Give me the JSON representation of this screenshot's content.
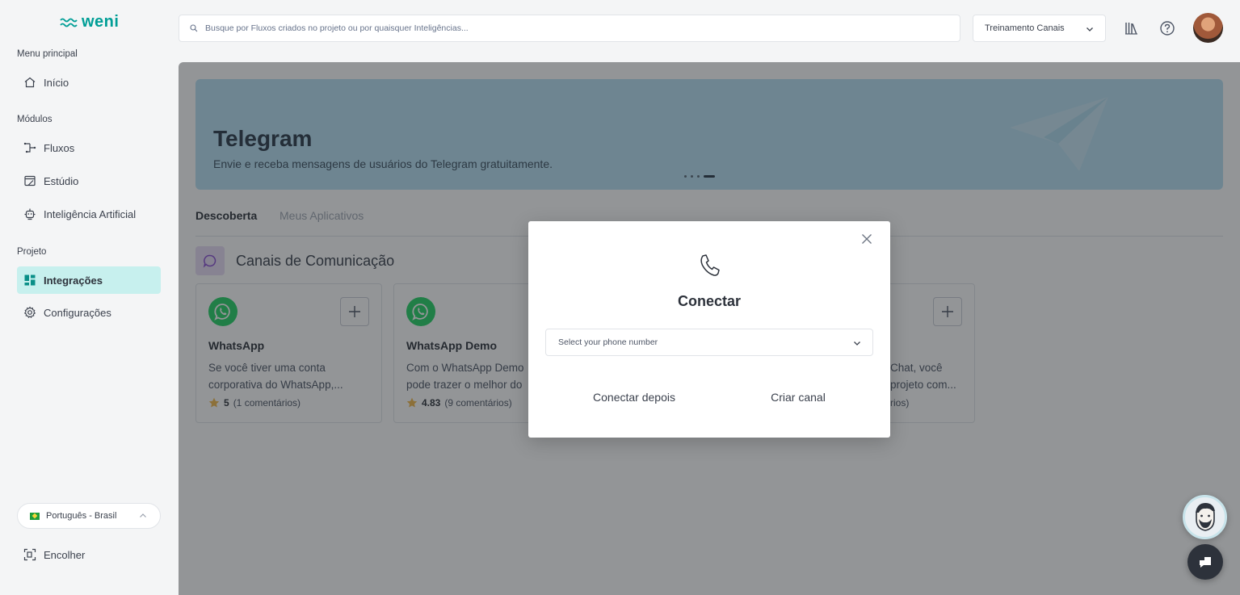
{
  "brand": {
    "name": "weni",
    "color": "#009e96"
  },
  "sidebar": {
    "sections": [
      {
        "label": "Menu principal"
      },
      {
        "label": "Módulos"
      },
      {
        "label": "Projeto"
      }
    ],
    "items": [
      {
        "label": "Início",
        "icon": "home-icon"
      },
      {
        "label": "Fluxos",
        "icon": "flows-icon"
      },
      {
        "label": "Estúdio",
        "icon": "studio-icon"
      },
      {
        "label": "Inteligência Artificial",
        "icon": "ai-icon"
      },
      {
        "label": "Integrações",
        "icon": "integrations-icon",
        "active": true
      },
      {
        "label": "Configurações",
        "icon": "settings-icon"
      }
    ],
    "language": "Português - Brasil",
    "collapse_label": "Encolher"
  },
  "header": {
    "search_placeholder": "Busque por Fluxos criados no projeto ou por quaisquer Inteligências...",
    "project": "Treinamento Canais"
  },
  "banner": {
    "title": "Telegram",
    "subtitle": "Envie e receba mensagens de usuários do Telegram gratuitamente.",
    "color": "#b8e1f3"
  },
  "tabs": [
    {
      "label": "Descoberta",
      "active": true
    },
    {
      "label": "Meus Aplicativos",
      "active": false
    }
  ],
  "section": {
    "title": "Canais de Comunicação"
  },
  "cards": [
    {
      "title": "WhatsApp",
      "desc1": "Se você tiver uma conta",
      "desc2": "corporativa do WhatsApp,...",
      "rating": "5",
      "comments": "(1 comentários)"
    },
    {
      "title": "WhatsApp Demo",
      "desc1": "Com o WhatsApp Demo",
      "desc2": "pode trazer o melhor do",
      "rating": "4.83",
      "comments": "(9 comentários)"
    },
    {
      "desc1": "Chat, você",
      "desc2": "projeto com...",
      "comments": "rios)"
    }
  ],
  "modal": {
    "title": "Conectar",
    "select_placeholder": "Select your phone number",
    "btn_later": "Conectar depois",
    "btn_create": "Criar canal"
  }
}
